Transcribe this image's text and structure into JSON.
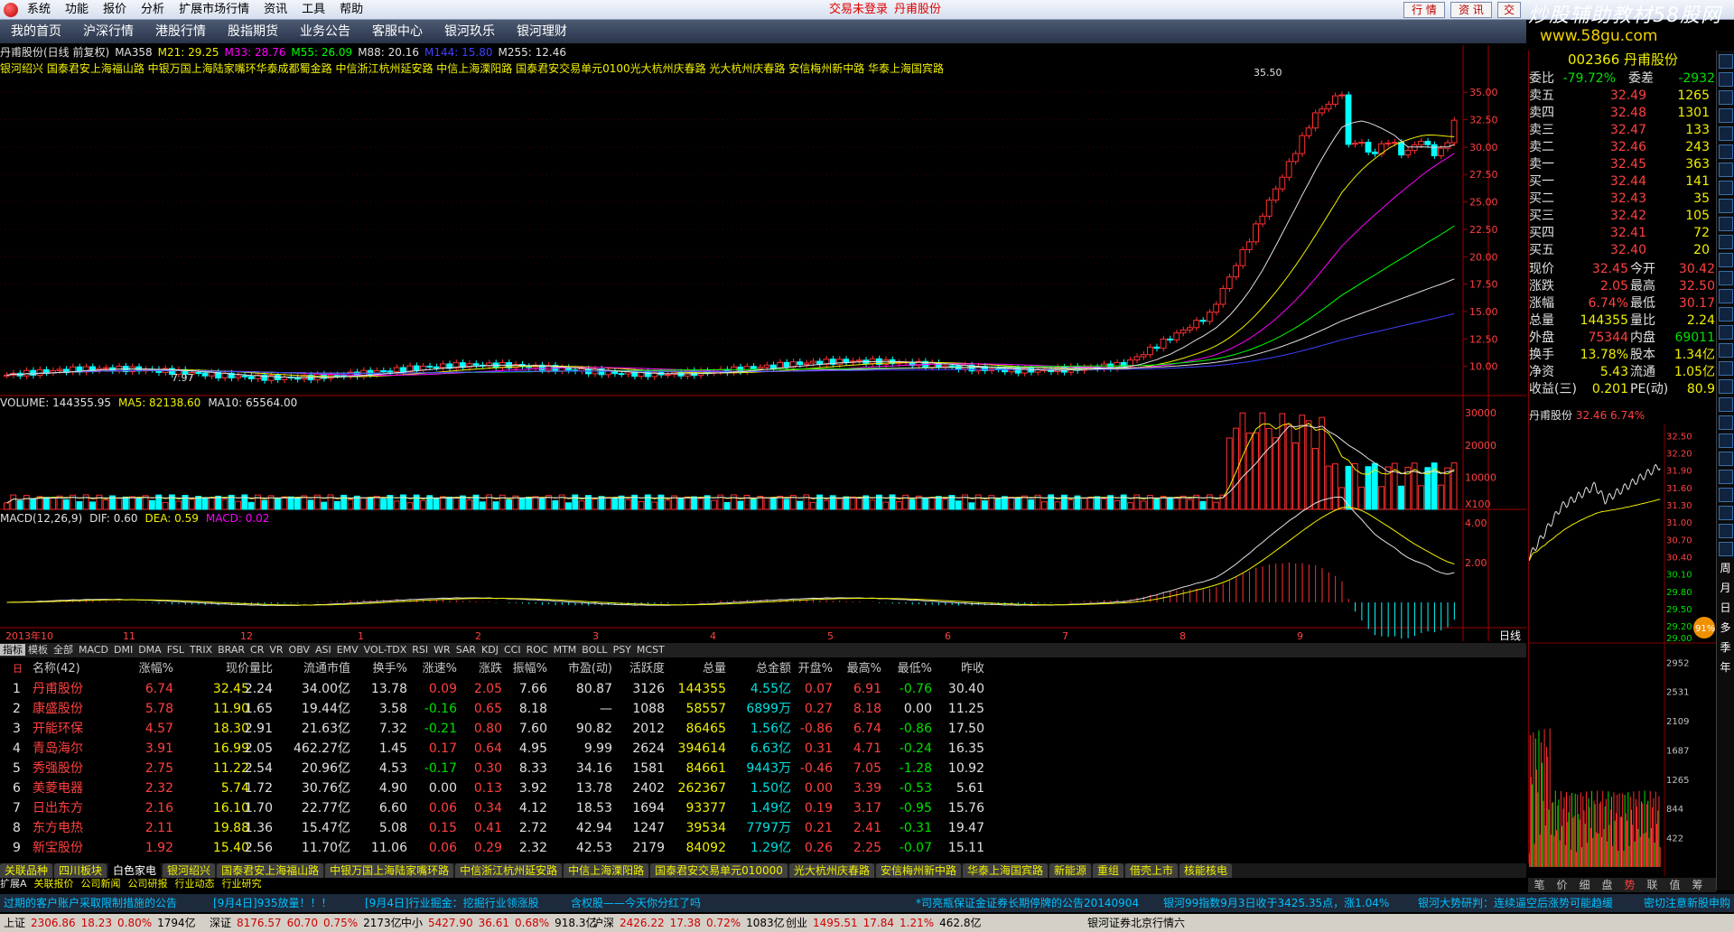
{
  "menu": [
    "系统",
    "功能",
    "报价",
    "分析",
    "扩展市场行情",
    "资讯",
    "工具",
    "帮助"
  ],
  "titlebar": {
    "status": "交易未登录",
    "stock": "丹甫股份",
    "buttons": [
      "行 情",
      "资 讯",
      "交"
    ]
  },
  "watermark": "炒股辅助教材58股网",
  "watermark_url": "www.58gu.com",
  "nav": [
    "我的首页",
    "沪深行情",
    "港股行情",
    "股指期货",
    "业务公告",
    "客服中心",
    "银河玖乐",
    "银河理财"
  ],
  "chart_title": {
    "name": "丹甫股份(日线 前复权)",
    "ma": [
      {
        "label": "MA358",
        "color": "#e0e0e0"
      },
      {
        "label": "M21: 29.25",
        "color": "#f0f000"
      },
      {
        "label": "M33: 28.76",
        "color": "#ff00ff"
      },
      {
        "label": "M55: 26.09",
        "color": "#00ff00"
      },
      {
        "label": "M88: 20.16",
        "color": "#e0e0e0"
      },
      {
        "label": "M144: 15.80",
        "color": "#4040ff"
      },
      {
        "label": "M255: 12.46",
        "color": "#e0e0e0"
      }
    ]
  },
  "bk_row": "银河绍兴 国泰君安上海福山路 中银万国上海陆家嘴环华泰成都蜀金路 中信浙江杭州延安路 中信上海溧阳路 国泰君安交易单元0100光大杭州庆春路 光大杭州庆春路 安信梅州新中路 华泰上海国宾路",
  "chart_annotations": {
    "high": "35.50",
    "low": "7.97"
  },
  "price_axis": [
    "35.00",
    "32.50",
    "30.00",
    "27.50",
    "25.00",
    "22.50",
    "20.00",
    "17.50",
    "15.00",
    "12.50",
    "10.00"
  ],
  "vol_title": [
    {
      "t": "VOLUME: 144355.95",
      "c": "#e0e0e0"
    },
    {
      "t": "MA5: 82138.60",
      "c": "#f0f000"
    },
    {
      "t": "MA10: 65564.00",
      "c": "#e0e0e0"
    }
  ],
  "vol_axis": [
    "30000",
    "20000",
    "10000",
    "X100"
  ],
  "macd_title": [
    {
      "t": "MACD(12,26,9)",
      "c": "#e0e0e0"
    },
    {
      "t": "DIF: 0.60",
      "c": "#e0e0e0"
    },
    {
      "t": "DEA: 0.59",
      "c": "#f0f000"
    },
    {
      "t": "MACD: 0.02",
      "c": "#ff00ff"
    }
  ],
  "macd_axis": [
    "4.00",
    "2.00"
  ],
  "x_axis": [
    "2013年10",
    "11",
    "12",
    "1",
    "2",
    "3",
    "4",
    "5",
    "6",
    "7",
    "8",
    "9"
  ],
  "indicator_tabs": [
    "指标",
    "模板",
    "全部",
    "MACD",
    "DMI",
    "DMA",
    "FSL",
    "TRIX",
    "BRAR",
    "CR",
    "VR",
    "OBV",
    "ASI",
    "EMV",
    "VOL-TDX",
    "RSI",
    "WR",
    "SAR",
    "KDJ",
    "CCI",
    "ROC",
    "MTM",
    "BOLL",
    "PSY",
    "MCST"
  ],
  "period": "日线",
  "table": {
    "headers": [
      "名称(42)",
      "涨幅%",
      "现价",
      "量比",
      "流通市值",
      "换手%",
      "涨速%",
      "涨跌",
      "振幅%",
      "市盈(动)",
      "活跃度",
      "总量",
      "总金额",
      "开盘%",
      "最高%",
      "最低%",
      "昨收"
    ],
    "rows": [
      [
        "1",
        "丹甫股份",
        "6.74",
        "32.45",
        "2.24",
        "34.00亿",
        "13.78",
        "0.09",
        "2.05",
        "7.66",
        "80.87",
        "3126",
        "144355",
        "4.55亿",
        "0.07",
        "6.91",
        "-0.76",
        "30.40"
      ],
      [
        "2",
        "康盛股份",
        "5.78",
        "11.90",
        "1.65",
        "19.44亿",
        "3.58",
        "-0.16",
        "0.65",
        "8.18",
        "—",
        "1088",
        "58557",
        "6899万",
        "0.27",
        "8.18",
        "0.00",
        "11.25"
      ],
      [
        "3",
        "开能环保",
        "4.57",
        "18.30",
        "2.91",
        "21.63亿",
        "7.32",
        "-0.21",
        "0.80",
        "7.60",
        "90.82",
        "2012",
        "86465",
        "1.56亿",
        "-0.86",
        "6.74",
        "-0.86",
        "17.50"
      ],
      [
        "4",
        "青岛海尔",
        "3.91",
        "16.99",
        "2.05",
        "462.27亿",
        "1.45",
        "0.17",
        "0.64",
        "4.95",
        "9.99",
        "2624",
        "394614",
        "6.63亿",
        "0.31",
        "4.71",
        "-0.24",
        "16.35"
      ],
      [
        "5",
        "秀强股份",
        "2.75",
        "11.22",
        "2.54",
        "20.96亿",
        "4.53",
        "-0.17",
        "0.30",
        "8.33",
        "34.16",
        "1581",
        "84661",
        "9443万",
        "-0.46",
        "7.05",
        "-1.28",
        "10.92"
      ],
      [
        "6",
        "美菱电器",
        "2.32",
        "5.74",
        "1.72",
        "30.76亿",
        "4.90",
        "0.00",
        "0.13",
        "3.92",
        "13.78",
        "2402",
        "262367",
        "1.50亿",
        "0.00",
        "3.39",
        "-0.53",
        "5.61"
      ],
      [
        "7",
        "日出东方",
        "2.16",
        "16.10",
        "1.70",
        "22.77亿",
        "6.60",
        "0.06",
        "0.34",
        "4.12",
        "18.53",
        "1694",
        "93377",
        "1.49亿",
        "0.19",
        "3.17",
        "-0.95",
        "15.76"
      ],
      [
        "8",
        "东方电热",
        "2.11",
        "19.88",
        "1.36",
        "15.47亿",
        "5.08",
        "0.15",
        "0.41",
        "2.72",
        "42.94",
        "1247",
        "39534",
        "7797万",
        "0.21",
        "2.41",
        "-0.31",
        "19.47"
      ],
      [
        "9",
        "新宝股份",
        "1.92",
        "15.40",
        "2.56",
        "11.70亿",
        "11.06",
        "0.06",
        "0.29",
        "2.32",
        "42.53",
        "2179",
        "84092",
        "1.29亿",
        "0.26",
        "2.25",
        "-0.07",
        "15.11"
      ]
    ]
  },
  "bottom_tabs": [
    "关联品种",
    "四川板块",
    "白色家电",
    "银河绍兴",
    "国泰君安上海福山路",
    "中银万国上海陆家嘴环路",
    "中信浙江杭州延安路",
    "中信上海溧阳路",
    "国泰君安交易单元010000",
    "光大杭州庆春路",
    "安信梅州新中路",
    "华泰上海国宾路",
    "新能源",
    "重组",
    "借壳上市",
    "核能核电"
  ],
  "sub_links": [
    "扩展A",
    "关联报价",
    "公司新闻",
    "公司研报",
    "行业动态",
    "行业研究"
  ],
  "ticker": [
    "过期的客户账户采取限制措施的公告",
    "[9月4日]935放量！！！",
    "[9月4日]行业掘金：挖掘行业领涨股",
    "含权股——今天你分红了吗",
    "*司亮瓶保证金证券长期停牌的公告20140904",
    "银河99指数9月3日收于3425.35点，涨1.04%",
    "银河大势研判：连续逼空后涨势可能趋缓",
    "密切注意新股申购"
  ],
  "status": {
    "sh": [
      "上证",
      "2306.86",
      "18.23",
      "0.80%",
      "1794亿"
    ],
    "sz": [
      "深证",
      "8176.57",
      "60.70",
      "0.75%",
      "2173亿"
    ],
    "zx": [
      "中小",
      "5427.90",
      "36.61",
      "0.68%",
      "918.3亿"
    ],
    "hs": [
      "沪深",
      "2426.22",
      "17.38",
      "0.72%",
      "1083亿"
    ],
    "cy": [
      "创业",
      "1495.51",
      "17.84",
      "1.21%",
      "462.8亿"
    ],
    "server": "银河证券北京行情六"
  },
  "side": {
    "code": "002366 丹甫股份",
    "webi": {
      "l1": "委比",
      "v1": "-79.72%",
      "l2": "委差",
      "v2": "-2932"
    },
    "asks": [
      [
        "卖五",
        "32.49",
        "1265"
      ],
      [
        "卖四",
        "32.48",
        "1301"
      ],
      [
        "卖三",
        "32.47",
        "133"
      ],
      [
        "卖二",
        "32.46",
        "243"
      ],
      [
        "卖一",
        "32.45",
        "363"
      ]
    ],
    "bids": [
      [
        "买一",
        "32.44",
        "141"
      ],
      [
        "买二",
        "32.43",
        "35"
      ],
      [
        "买三",
        "32.42",
        "105"
      ],
      [
        "买四",
        "32.41",
        "72"
      ],
      [
        "买五",
        "32.40",
        "20"
      ]
    ],
    "stats": [
      [
        "现价",
        "32.45",
        "今开",
        "30.42"
      ],
      [
        "涨跌",
        "2.05",
        "最高",
        "32.50"
      ],
      [
        "涨幅",
        "6.74%",
        "最低",
        "30.17"
      ],
      [
        "总量",
        "144355",
        "量比",
        "2.24"
      ],
      [
        "外盘",
        "75344",
        "内盘",
        "69011"
      ],
      [
        "换手",
        "13.78%",
        "股本",
        "1.34亿"
      ],
      [
        "净资",
        "5.43",
        "流通",
        "1.05亿"
      ],
      [
        "收益(三)",
        "0.201",
        "PE(动)",
        "80.9"
      ]
    ],
    "mini_title": "丹甫股份",
    "mini_price": "32.46",
    "mini_pct": "6.74%",
    "mini_axis": [
      "32.50",
      "32.20",
      "31.90",
      "31.60",
      "31.30",
      "31.00",
      "30.70",
      "30.40",
      "30.10",
      "29.80",
      "29.50",
      "29.20",
      "29.00"
    ],
    "vol_axis": [
      "2952",
      "2531",
      "2109",
      "1687",
      "1265",
      "844",
      "422"
    ],
    "badge": "91%",
    "tabs": [
      "笔",
      "价",
      "细",
      "盘",
      "势",
      "联",
      "值",
      "筹"
    ]
  },
  "right_tools": [
    "周",
    "月",
    "日",
    "多",
    "季",
    "年"
  ]
}
